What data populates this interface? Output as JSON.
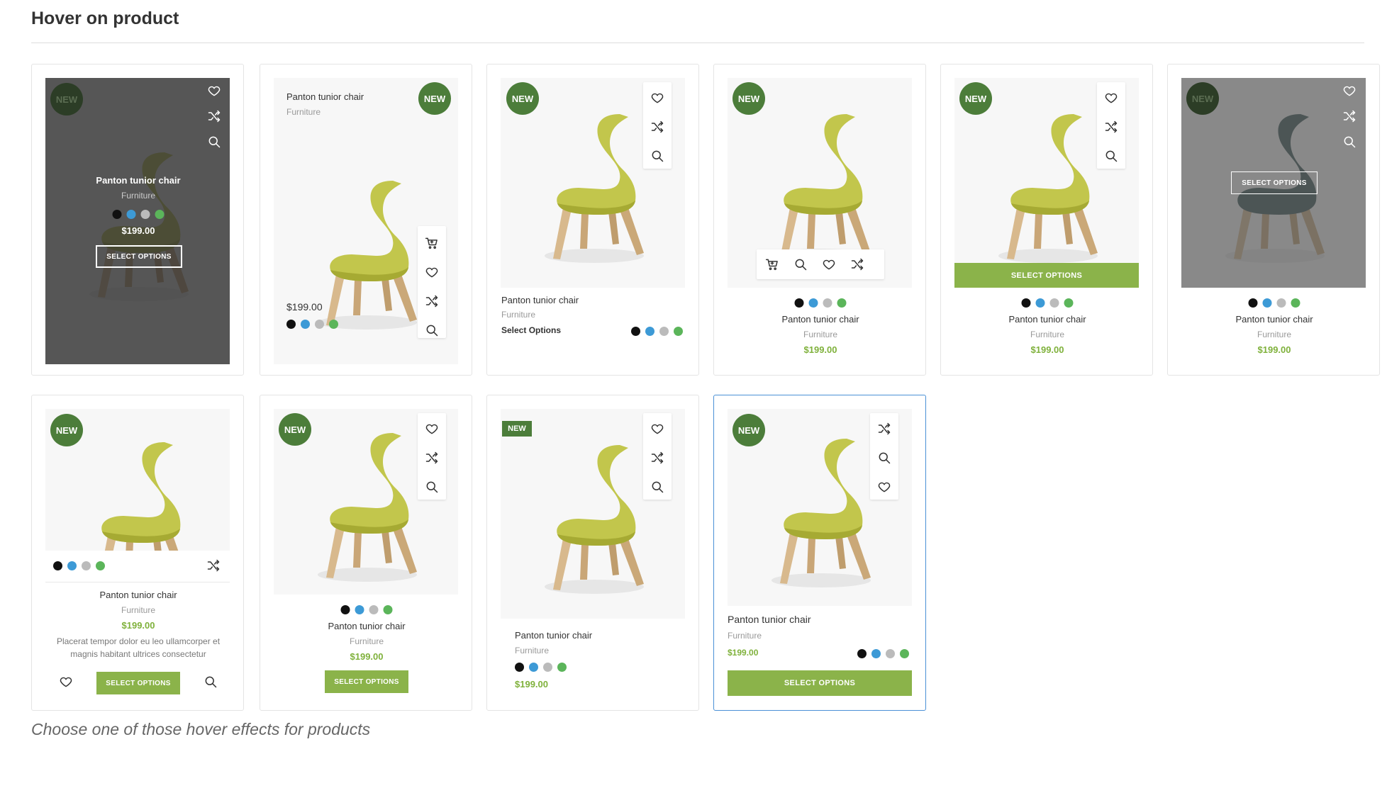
{
  "page": {
    "title": "Hover on product",
    "caption": "Choose one of those hover effects for products"
  },
  "product": {
    "name": "Panton tunior chair",
    "category": "Furniture",
    "price": "$199.00",
    "badge": "NEW",
    "select_label": "SELECT OPTIONS",
    "select_link": "Select Options",
    "description": "Placerat tempor dolor eu leo ullamcorper et magnis habitant ultrices consectetur"
  },
  "colors": {
    "accent": "#8bb34a",
    "badge": "#4c7d3a",
    "swatches": [
      "#111111",
      "#3d9ad6",
      "#bbbbbb",
      "#5bb55a"
    ],
    "selected_border": "#4a90d6"
  },
  "icons": [
    "heart-icon",
    "shuffle-icon",
    "search-icon",
    "cart-icon"
  ]
}
